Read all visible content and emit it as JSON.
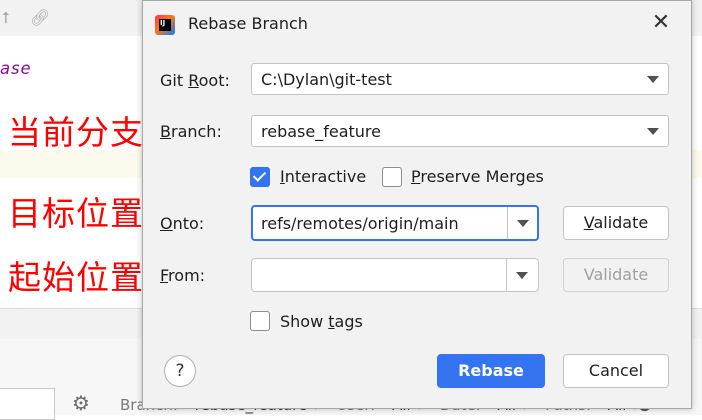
{
  "background": {
    "code_text": "ase",
    "annotations": [
      "当前分支",
      "目标位置",
      "起始位置"
    ],
    "filters": {
      "branch_label": "Branch:",
      "branch_value": "rebase_feature",
      "user_label": "User:",
      "user_value": "All",
      "date_label": "Date:",
      "date_value": "All",
      "paths_label": "Paths:",
      "paths_value": "All"
    },
    "icons": [
      "arrow-up-icon",
      "link-icon",
      "gear-icon",
      "g-icon",
      "pin-icon"
    ]
  },
  "dialog": {
    "title": "Rebase Branch",
    "git_root": {
      "label_pre": "Git ",
      "label_mnemonic": "R",
      "label_post": "oot:",
      "value": "C:\\Dylan\\git-test"
    },
    "branch": {
      "label_pre": "",
      "label_mnemonic": "B",
      "label_post": "ranch:",
      "value": "rebase_feature"
    },
    "interactive": {
      "label_pre": "",
      "label_mnemonic": "I",
      "label_post": "nteractive",
      "checked": true
    },
    "preserve_merges": {
      "label_pre": "",
      "label_mnemonic": "P",
      "label_post": "reserve Merges",
      "checked": false
    },
    "onto": {
      "label_pre": "",
      "label_mnemonic": "O",
      "label_post": "nto:",
      "value": "refs/remotes/origin/main"
    },
    "from": {
      "label_pre": "",
      "label_mnemonic": "F",
      "label_post": "rom:",
      "value": ""
    },
    "validate_onto": {
      "label_pre": "",
      "label_mnemonic": "V",
      "label_post": "alidate"
    },
    "validate_from": {
      "label": "Validate"
    },
    "show_tags": {
      "label_pre": "Show ",
      "label_mnemonic": "t",
      "label_post": "ags",
      "checked": false
    },
    "help_label": "?",
    "rebase_button": "Rebase",
    "cancel_button": "Cancel"
  },
  "colors": {
    "accent": "#3574f0",
    "annotation": "#ff0000"
  }
}
